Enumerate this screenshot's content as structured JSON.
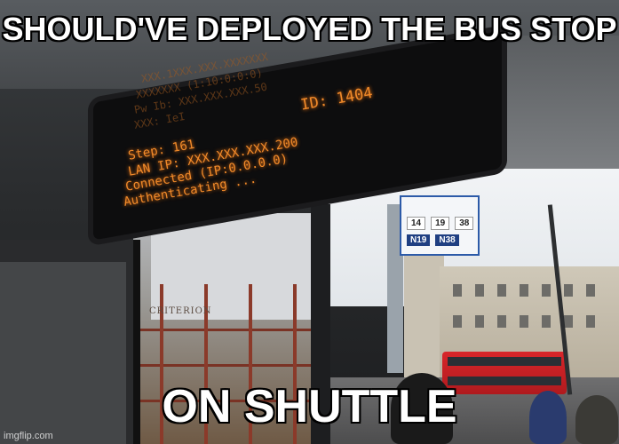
{
  "meme": {
    "top_caption": "SHOULD'VE DEPLOYED THE BUS STOP",
    "bottom_caption": "ON SHUTTLE",
    "watermark": "imgflip.com"
  },
  "display": {
    "id_label": "ID: 1404",
    "lines": [
      "Step: 161",
      "LAN IP: XXX.XXX.XXX.200",
      "Connected (IP:0.0.0.0)",
      "Authenticating ..."
    ],
    "faint_lines": [
      "XXX.1XXX.XXX.XXXXXXX",
      "XXXXXXX (1:10:0:0:0)",
      "Pw Ib: XXX.XXX.XXX.50",
      "XXX: IeI"
    ]
  },
  "bus_stop_sign": {
    "routes_row1": [
      "14",
      "19",
      "38"
    ],
    "routes_row2": [
      "N19",
      "N38"
    ]
  },
  "scaffold_sign": "CRITERION"
}
